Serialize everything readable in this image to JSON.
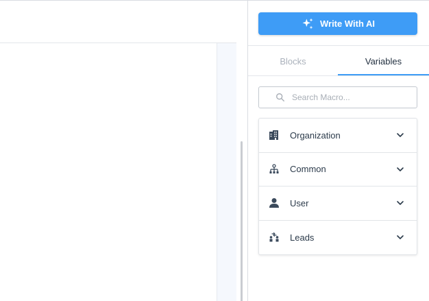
{
  "panel": {
    "ai_button_label": "Write With AI",
    "tabs": [
      {
        "label": "Blocks",
        "active": false
      },
      {
        "label": "Variables",
        "active": true
      }
    ],
    "search": {
      "placeholder": "Search Macro...",
      "value": ""
    },
    "variables": [
      {
        "label": "Organization",
        "icon": "building-icon"
      },
      {
        "label": "Common",
        "icon": "hierarchy-icon"
      },
      {
        "label": "User",
        "icon": "user-icon"
      },
      {
        "label": "Leads",
        "icon": "leads-icon"
      }
    ]
  },
  "colors": {
    "accent": "#3e9cf6",
    "text": "#2b3a4a",
    "muted_tab": "#aab1bb"
  }
}
